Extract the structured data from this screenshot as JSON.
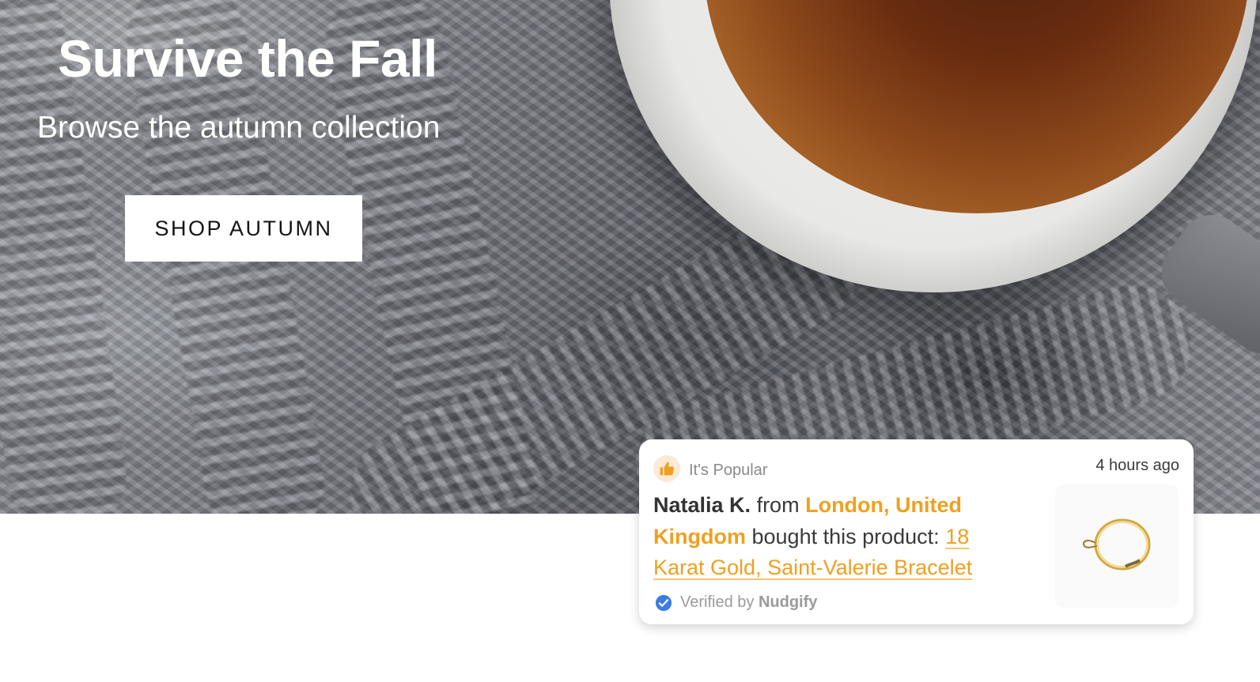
{
  "hero": {
    "title": "Survive the Fall",
    "subtitle": "Browse the autumn collection",
    "cta_label": "SHOP AUTUMN"
  },
  "popup": {
    "badge_icon": "thumbs-up-icon",
    "category": "It's Popular",
    "time": "4 hours ago",
    "buyer_name": "Natalia K.",
    "from_word": "from",
    "location": "London, United Kingdom",
    "action_text": "bought this product:",
    "product_name": "18 Karat Gold, Saint-Valerie Bracelet",
    "product_image_icon": "gold-bracelet-icon",
    "verified_icon": "verified-check-icon",
    "verified_text": "Verified by",
    "verified_brand": "Nudgify"
  },
  "colors": {
    "accent": "#f0a020",
    "badge_bg": "#fde9d6",
    "verified_blue": "#3b7de0",
    "text_dark": "#333333",
    "text_muted": "#9a9a9a"
  }
}
